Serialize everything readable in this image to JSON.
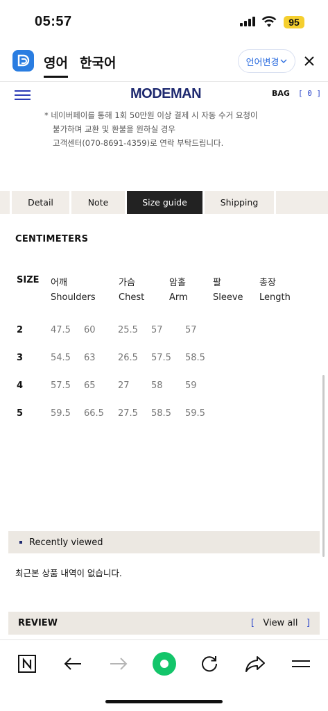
{
  "status": {
    "time": "05:57",
    "battery": "95"
  },
  "translate_bar": {
    "tab_active": "영어",
    "tab_other": "한국어",
    "change_btn": "언어변경"
  },
  "header": {
    "brand": "MODEMAN",
    "bag_label": "BAG",
    "bag_count": "[ 0 ]"
  },
  "notice": {
    "line1": "*  네이버페이를 통해 1회 50만원 이상 결제 시 자동 수거 요청이",
    "line2": "불가하며 교환 및 환불을 원하실 경우",
    "line3": "고객센터(070-8691-4359)로 연락 부탁드립니다."
  },
  "tabs": [
    "Detail",
    "Note",
    "Size guide",
    "Shipping"
  ],
  "unit_heading": "CENTIMETERS",
  "size_table": {
    "size_label": "SIZE",
    "headers_ko": [
      "어깨",
      "가슴",
      "암홀",
      "팔",
      "총장"
    ],
    "headers_en": [
      "Shoulders",
      "Chest",
      "Arm",
      "Sleeve",
      "Length"
    ],
    "rows": [
      {
        "size": "2",
        "values": [
          "47.5",
          "60",
          "25.5",
          "57",
          "57"
        ]
      },
      {
        "size": "3",
        "values": [
          "54.5",
          "63",
          "26.5",
          "57.5",
          "58.5"
        ]
      },
      {
        "size": "4",
        "values": [
          "57.5",
          "65",
          "27",
          "58",
          "59"
        ]
      },
      {
        "size": "5",
        "values": [
          "59.5",
          "66.5",
          "27.5",
          "58.5",
          "59.5"
        ]
      }
    ]
  },
  "recently_viewed": {
    "title": "Recently viewed",
    "empty_text": "최근본 상품 내역이 없습니다."
  },
  "review": {
    "title": "REVIEW",
    "bracket_open": "[",
    "view_all": "View all",
    "bracket_close": "]"
  },
  "icons": [
    "naver-n-icon",
    "back-arrow-icon",
    "forward-arrow-icon",
    "green-dot-icon",
    "refresh-icon",
    "share-icon",
    "menu-icon"
  ],
  "colors": {
    "accent_blue": "#2a44c9",
    "brand_navy": "#1f2a70",
    "tab_bg": "#f1ede8",
    "active_tab": "#222222",
    "green": "#13c56a",
    "battery": "#f5cf2f"
  }
}
